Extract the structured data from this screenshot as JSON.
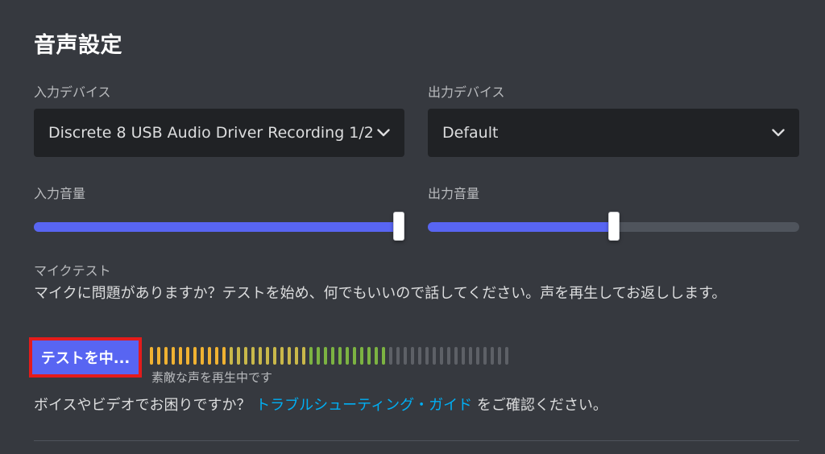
{
  "section": {
    "title": "音声設定"
  },
  "input_device": {
    "label": "入力デバイス",
    "selected": "Discrete 8 USB Audio Driver Recording 1/2"
  },
  "output_device": {
    "label": "出力デバイス",
    "selected": "Default"
  },
  "input_volume": {
    "label": "入力音量",
    "value_percent": 100
  },
  "output_volume": {
    "label": "出力音量",
    "value_percent": 50
  },
  "mic_test": {
    "label": "マイクテスト",
    "description": "マイクに問題がありますか？テストを始め、何でもいいので話してください。声を再生してお返しします。",
    "button_label": "テストを中...",
    "meter_caption": "素敵な声を再生中です",
    "meter_total_bars": 50,
    "meter_active_bars": 33,
    "meter_colors": {
      "low": "#f0b232",
      "mid": "#c9b84a",
      "high": "#7cb342",
      "inactive": "#5d6066"
    }
  },
  "help": {
    "prefix": "ボイスやビデオでお困りですか？ ",
    "link": "トラブルシューティング・ガイド",
    "suffix": " をご確認ください。"
  },
  "colors": {
    "accent": "#5865f2",
    "link": "#00aff4",
    "highlight_border": "#e41b1b"
  }
}
